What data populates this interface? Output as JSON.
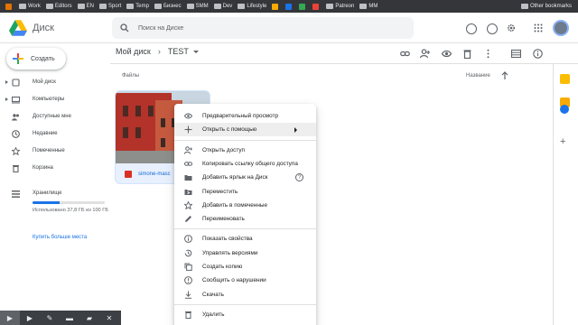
{
  "bookmarks": [
    {
      "label": "",
      "color": "#e37400"
    },
    {
      "label": "Work",
      "folder": true
    },
    {
      "label": "Editors",
      "folder": true
    },
    {
      "label": "EN",
      "folder": true
    },
    {
      "label": "Sport",
      "folder": true
    },
    {
      "label": "Temp",
      "folder": true
    },
    {
      "label": "Бизнес",
      "folder": true
    },
    {
      "label": "SMM",
      "folder": true
    },
    {
      "label": "Dev",
      "folder": true
    },
    {
      "label": "Lifestyle",
      "folder": true
    },
    {
      "label": "",
      "color": "#f9ab00"
    },
    {
      "label": "",
      "color": "#1a73e8"
    },
    {
      "label": "",
      "color": "#34a853"
    },
    {
      "label": "",
      "color": "#ea4335"
    },
    {
      "label": "Patreon",
      "folder": true
    },
    {
      "label": "MM",
      "folder": true
    }
  ],
  "bookmarks_other": "Other bookmarks",
  "app": {
    "title": "Диск"
  },
  "search": {
    "placeholder": "Поиск на Диске"
  },
  "new_button": "Создать",
  "sidebar": {
    "items": [
      {
        "label": "Мой диск",
        "icon": "drive-icon",
        "caret": true
      },
      {
        "label": "Компьютеры",
        "icon": "computer-icon",
        "caret": true
      },
      {
        "label": "Доступные мне",
        "icon": "shared-icon",
        "caret": false
      },
      {
        "label": "Недавние",
        "icon": "clock-icon",
        "caret": false
      },
      {
        "label": "Помеченные",
        "icon": "star-icon",
        "caret": false
      },
      {
        "label": "Корзина",
        "icon": "trash-icon",
        "caret": false
      }
    ],
    "storage_label": "Хранилище",
    "storage_text": "Использовано 37,8 ГБ из 100 ГБ",
    "storage_fraction": 0.378,
    "buy_link": "Купить больше места"
  },
  "breadcrumb": {
    "root": "Мой диск",
    "current": "TEST"
  },
  "files_label": "Файлы",
  "sort_label": "Название",
  "file": {
    "name": "simone-masc"
  },
  "context_menu": [
    {
      "label": "Предварительный просмотр",
      "icon": "eye-icon"
    },
    {
      "label": "Открыть с помощью",
      "icon": "move-arrows-icon",
      "submenu": true,
      "highlighted": true
    },
    {
      "sep": true
    },
    {
      "label": "Открыть доступ",
      "icon": "person-add-icon"
    },
    {
      "label": "Копировать ссылку общего доступа",
      "icon": "link-icon"
    },
    {
      "label": "Добавить ярлык на Диск",
      "icon": "shortcut-icon",
      "help": true
    },
    {
      "label": "Переместить",
      "icon": "folder-move-icon"
    },
    {
      "label": "Добавить в помеченные",
      "icon": "star-icon"
    },
    {
      "label": "Переименовать",
      "icon": "pencil-icon"
    },
    {
      "sep": true
    },
    {
      "label": "Показать свойства",
      "icon": "info-icon"
    },
    {
      "label": "Управлять версиями",
      "icon": "history-icon"
    },
    {
      "label": "Создать копию",
      "icon": "copy-icon"
    },
    {
      "label": "Сообщить о нарушении",
      "icon": "report-icon"
    },
    {
      "label": "Скачать",
      "icon": "download-icon"
    },
    {
      "sep": true
    },
    {
      "label": "Удалить",
      "icon": "trash-icon"
    }
  ],
  "help_glyph": "?",
  "overlay_glyphs": [
    "▶",
    "▶",
    "✎",
    "▬",
    "▰",
    "✕"
  ],
  "colors": {
    "accent": "#1a73e8",
    "highlight": "#eeeeee",
    "header_bar": "#35363a"
  }
}
